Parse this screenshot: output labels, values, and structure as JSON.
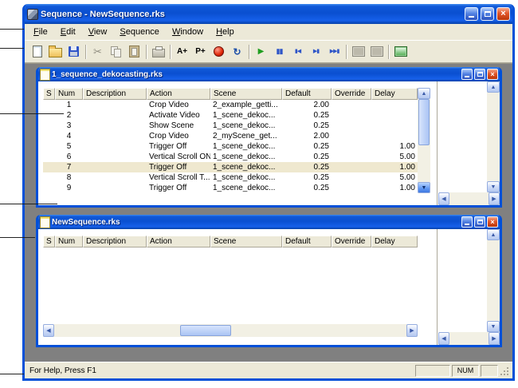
{
  "window": {
    "title": "Sequence - NewSequence.rks",
    "menu": [
      "File",
      "Edit",
      "View",
      "Sequence",
      "Window",
      "Help"
    ]
  },
  "toolbar": {
    "a_plus": "A+",
    "p_plus": "P+"
  },
  "columns": [
    "S",
    "Num",
    "Description",
    "Action",
    "Scene",
    "Default",
    "Override",
    "Delay"
  ],
  "child1": {
    "title": "1_sequence_dekocasting.rks",
    "rows": [
      {
        "s": "",
        "num": "1",
        "description": "",
        "action": "Crop Video",
        "scene": "2_example_getti...",
        "default": "2.00",
        "override": "",
        "delay": ""
      },
      {
        "s": "",
        "num": "2",
        "description": "",
        "action": "Activate Video",
        "scene": "1_scene_dekoc...",
        "default": "0.25",
        "override": "",
        "delay": ""
      },
      {
        "s": "",
        "num": "3",
        "description": "",
        "action": "Show Scene",
        "scene": "1_scene_dekoc...",
        "default": "0.25",
        "override": "",
        "delay": ""
      },
      {
        "s": "",
        "num": "4",
        "description": "",
        "action": "Crop Video",
        "scene": "2_myScene_get...",
        "default": "2.00",
        "override": "",
        "delay": ""
      },
      {
        "s": "",
        "num": "5",
        "description": "",
        "action": "Trigger Off",
        "scene": "1_scene_dekoc...",
        "default": "0.25",
        "override": "",
        "delay": "1.00"
      },
      {
        "s": "",
        "num": "6",
        "description": "",
        "action": "Vertical Scroll ON",
        "scene": "1_scene_dekoc...",
        "default": "0.25",
        "override": "",
        "delay": "5.00"
      },
      {
        "s": "",
        "num": "7",
        "description": "",
        "action": "Trigger Off",
        "scene": "1_scene_dekoc...",
        "default": "0.25",
        "override": "",
        "delay": "1.00"
      },
      {
        "s": "",
        "num": "8",
        "description": "",
        "action": "Vertical Scroll T...",
        "scene": "1_scene_dekoc...",
        "default": "0.25",
        "override": "",
        "delay": "5.00"
      },
      {
        "s": "",
        "num": "9",
        "description": "",
        "action": "Trigger Off",
        "scene": "1_scene_dekoc...",
        "default": "0.25",
        "override": "",
        "delay": "1.00"
      }
    ]
  },
  "child2": {
    "title": "NewSequence.rks"
  },
  "statusbar": {
    "help_text": "For Help, Press F1",
    "num_label": "NUM"
  },
  "icons": {
    "close": "×",
    "scroll_up": "▲",
    "scroll_down": "▼",
    "scroll_left": "◀",
    "scroll_right": "▶",
    "cut": "✂",
    "loop": "↻",
    "play": "▶",
    "pause": "▮▮",
    "skip_start": "▮◀",
    "step_forward": "▶▮",
    "skip_end": "▶▶▮"
  },
  "colors": {
    "titlebar_blue": "#0A4FD0",
    "window_border": "#0050D8",
    "mdi_gray": "#808080",
    "face": "#ECE9D8",
    "selected_row": "#EFE8CF",
    "close_red": "#E1562A"
  }
}
